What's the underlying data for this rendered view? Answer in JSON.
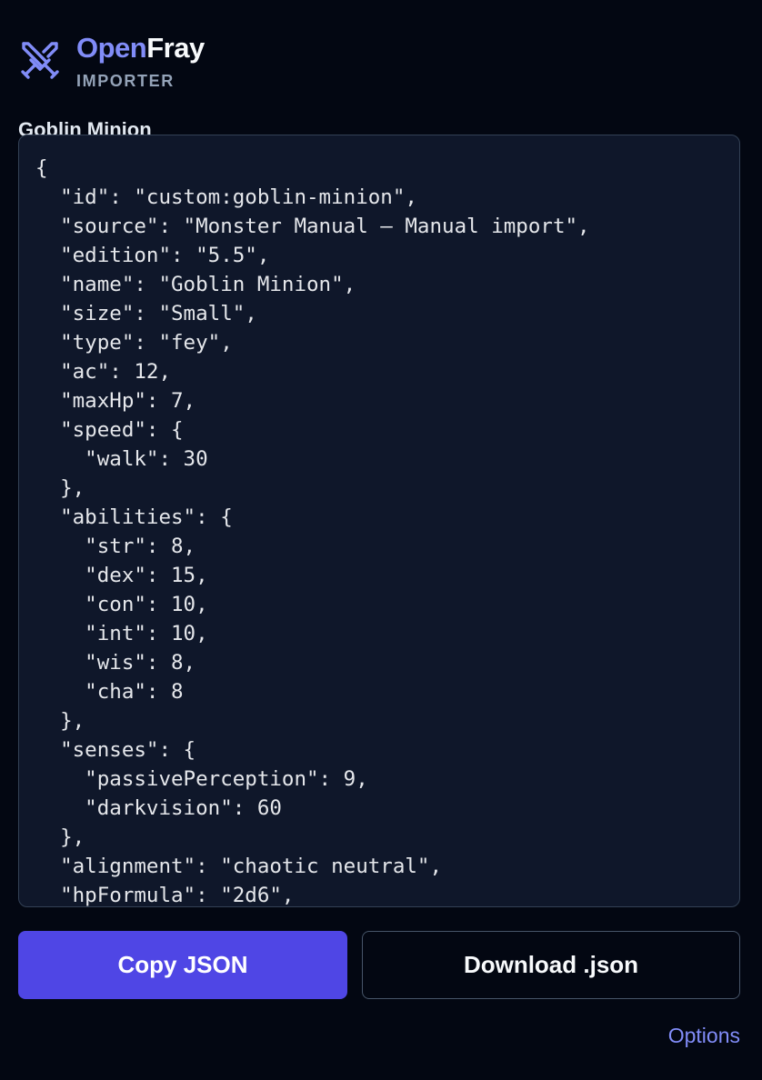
{
  "brand": {
    "name_part1": "Open",
    "name_part2": "Fray",
    "subtitle": "IMPORTER",
    "icon": "crossed-swords-icon",
    "accent_color": "#818cf8"
  },
  "monster": {
    "title": "Goblin Minion"
  },
  "json_preview": {
    "lines": [
      "{",
      "  \"id\": \"custom:goblin-minion\",",
      "  \"source\": \"Monster Manual – Manual import\",",
      "  \"edition\": \"5.5\",",
      "  \"name\": \"Goblin Minion\",",
      "  \"size\": \"Small\",",
      "  \"type\": \"fey\",",
      "  \"ac\": 12,",
      "  \"maxHp\": 7,",
      "  \"speed\": {",
      "    \"walk\": 30",
      "  },",
      "  \"abilities\": {",
      "    \"str\": 8,",
      "    \"dex\": 15,",
      "    \"con\": 10,",
      "    \"int\": 10,",
      "    \"wis\": 8,",
      "    \"cha\": 8",
      "  },",
      "  \"senses\": {",
      "    \"passivePerception\": 9,",
      "    \"darkvision\": 60",
      "  },",
      "  \"alignment\": \"chaotic neutral\",",
      "  \"hpFormula\": \"2d6\","
    ]
  },
  "actions": {
    "copy_label": "Copy JSON",
    "download_label": "Download .json",
    "primary_color": "#4f46e5"
  },
  "footer": {
    "options_label": "Options"
  }
}
